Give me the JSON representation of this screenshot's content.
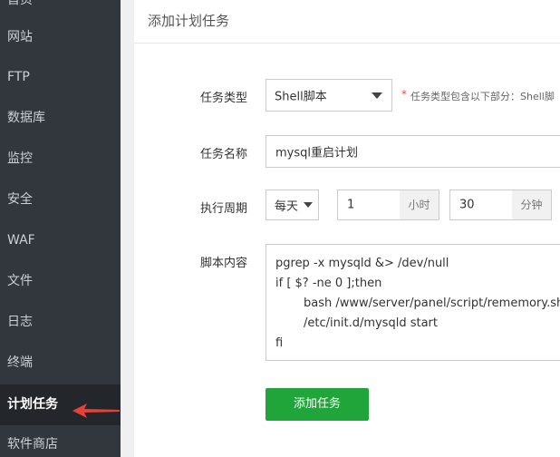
{
  "sidebar": {
    "items": [
      {
        "label": "首页"
      },
      {
        "label": "网站"
      },
      {
        "label": "FTP"
      },
      {
        "label": "数据库"
      },
      {
        "label": "监控"
      },
      {
        "label": "安全"
      },
      {
        "label": "WAF"
      },
      {
        "label": "文件"
      },
      {
        "label": "日志"
      },
      {
        "label": "终端"
      },
      {
        "label": "计划任务"
      },
      {
        "label": "软件商店"
      }
    ],
    "active": "计划任务"
  },
  "panel": {
    "title": "添加计划任务",
    "task_type": {
      "label": "任务类型",
      "value": "Shell脚本",
      "hint_star": "*",
      "hint": "任务类型包含以下部分：Shell脚"
    },
    "task_name": {
      "label": "任务名称",
      "value": "mysql重启计划"
    },
    "period": {
      "label": "执行周期",
      "frequency": "每天",
      "hour_value": "1",
      "hour_unit": "小时",
      "minute_value": "30",
      "minute_unit": "分钟"
    },
    "script": {
      "label": "脚本内容",
      "lines": [
        "pgrep -x mysqld &> /dev/null",
        "if [ $? -ne 0 ];then",
        "bash /www/server/panel/script/rememory.sh",
        "/etc/init.d/mysqld start",
        "fi"
      ]
    },
    "submit_label": "添加任务"
  },
  "colors": {
    "sidebar_bg": "#32373d",
    "sidebar_active_bg": "#23272b",
    "primary_button": "#20a53a",
    "arrow": "#e8413a",
    "spellcheck_underline": "#e0487a"
  }
}
